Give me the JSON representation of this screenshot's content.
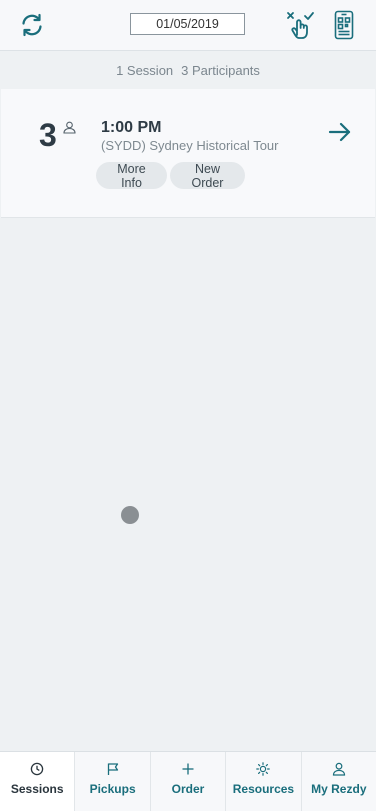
{
  "header": {
    "date_value": "01/05/2019",
    "icons": [
      "refresh-icon",
      "check-in-icon",
      "scan-icon"
    ]
  },
  "summary": {
    "sessions": "1 Session",
    "participants": "3 Participants"
  },
  "session": {
    "count": "3",
    "time": "1:00 PM",
    "tour": "(SYDD) Sydney Historical Tour",
    "more_info_label": "More Info",
    "new_order_label": "New Order"
  },
  "nav": {
    "items": [
      {
        "label": "Sessions",
        "icon": "clock-icon",
        "active": true
      },
      {
        "label": "Pickups",
        "icon": "flag-icon"
      },
      {
        "label": "Order",
        "icon": "plus-icon"
      },
      {
        "label": "Resources",
        "icon": "sun-icon"
      },
      {
        "label": "My Rezdy",
        "icon": "person-icon"
      }
    ]
  },
  "colors": {
    "accent": "#1a6e7c",
    "background": "#eef1f3"
  }
}
